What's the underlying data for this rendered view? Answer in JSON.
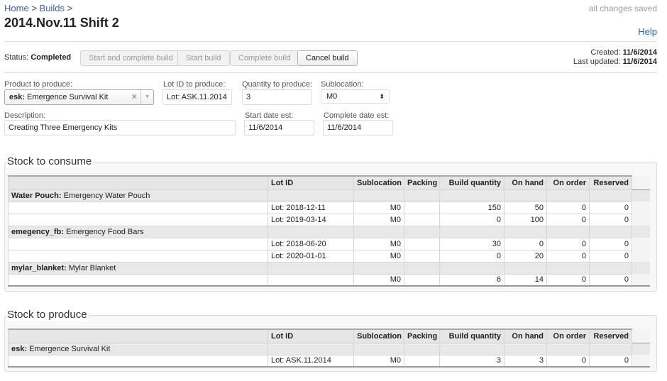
{
  "breadcrumb": [
    {
      "label": "Home",
      "sep": ">"
    },
    {
      "label": "Builds",
      "sep": ">"
    }
  ],
  "title": "2014.Nov.11 Shift 2",
  "save_status": "all changes saved",
  "help_label": "Help",
  "status": {
    "label": "Status:",
    "value": "Completed"
  },
  "buttons": {
    "start_and_complete": "Start and complete build",
    "start": "Start build",
    "complete": "Complete build",
    "cancel": "Cancel build"
  },
  "meta": {
    "created_label": "Created:",
    "created_value": "11/6/2014",
    "updated_label": "Last updated:",
    "updated_value": "11/6/2014"
  },
  "form": {
    "product_label": "Product to produce:",
    "product_code": "esk:",
    "product_name": "Emergence Survival Kit",
    "lot_label": "Lot ID to produce:",
    "lot_value": "Lot: ASK.11.2014",
    "quantity_label": "Quantity to produce:",
    "quantity_value": "3",
    "sublocation_label": "Sublocation:",
    "sublocation_value": "M0",
    "description_label": "Description:",
    "description_value": "Creating Three Emergency Kits",
    "start_date_label": "Start date est:",
    "start_date_value": "11/6/2014",
    "complete_date_label": "Complete date est:",
    "complete_date_value": "11/6/2014"
  },
  "columns": [
    "",
    "Lot ID",
    "Sublocation",
    "Packing",
    "Build quantity",
    "On hand",
    "On order",
    "Reserved"
  ],
  "consume": {
    "title": "Stock to consume",
    "groups": [
      {
        "code": "Water Pouch:",
        "name": "Emergency Water Pouch",
        "rows": [
          {
            "lot": "Lot: 2018-12-11",
            "subloc": "M0",
            "packing": "",
            "build_qty": "150",
            "on_hand": "50",
            "on_order": "0",
            "reserved": "0"
          },
          {
            "lot": "Lot: 2019-03-14",
            "subloc": "M0",
            "packing": "",
            "build_qty": "0",
            "on_hand": "100",
            "on_order": "0",
            "reserved": "0"
          }
        ]
      },
      {
        "code": "emegency_fb:",
        "name": "Emergency Food Bars",
        "rows": [
          {
            "lot": "Lot: 2018-06-20",
            "subloc": "M0",
            "packing": "",
            "build_qty": "30",
            "on_hand": "0",
            "on_order": "0",
            "reserved": "0"
          },
          {
            "lot": "Lot: 2020-01-01",
            "subloc": "M0",
            "packing": "",
            "build_qty": "0",
            "on_hand": "20",
            "on_order": "0",
            "reserved": "0"
          }
        ]
      },
      {
        "code": "mylar_blanket:",
        "name": "Mylar Blanket",
        "rows": [
          {
            "lot": "",
            "subloc": "M0",
            "packing": "",
            "build_qty": "6",
            "on_hand": "14",
            "on_order": "0",
            "reserved": "0"
          }
        ]
      }
    ]
  },
  "produce": {
    "title": "Stock to produce",
    "groups": [
      {
        "code": "esk:",
        "name": "Emergence Survival Kit",
        "rows": [
          {
            "lot": "Lot: ASK.11.2014",
            "subloc": "M0",
            "packing": "",
            "build_qty": "3",
            "on_hand": "3",
            "on_order": "0",
            "reserved": "0"
          }
        ]
      }
    ]
  }
}
